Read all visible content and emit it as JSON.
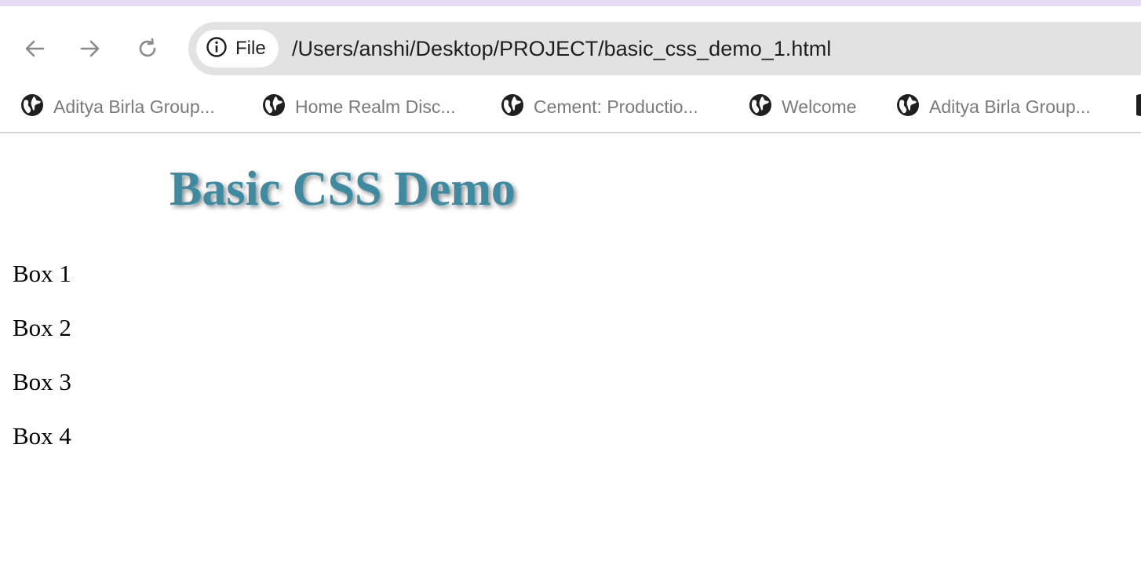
{
  "browser": {
    "site_chip_label": "File",
    "url": "/Users/anshi/Desktop/PROJECT/basic_css_demo_1.html",
    "bookmarks": [
      {
        "label": "Aditya Birla Group...",
        "icon": "globe-icon"
      },
      {
        "label": "Home Realm Disc...",
        "icon": "globe-icon"
      },
      {
        "label": "Cement: Productio...",
        "icon": "globe-icon"
      },
      {
        "label": "Welcome",
        "icon": "globe-icon"
      },
      {
        "label": "Aditya Birla Group...",
        "icon": "globe-icon"
      }
    ],
    "colors": {
      "top_strip": "#e7dcf7",
      "omnibox": "#e2e2e2",
      "bookmark_text": "#7a7a7a"
    }
  },
  "page": {
    "heading": "Basic CSS Demo",
    "heading_color": "#3e8ba1",
    "boxes": [
      "Box 1",
      "Box 2",
      "Box 3",
      "Box 4"
    ]
  }
}
